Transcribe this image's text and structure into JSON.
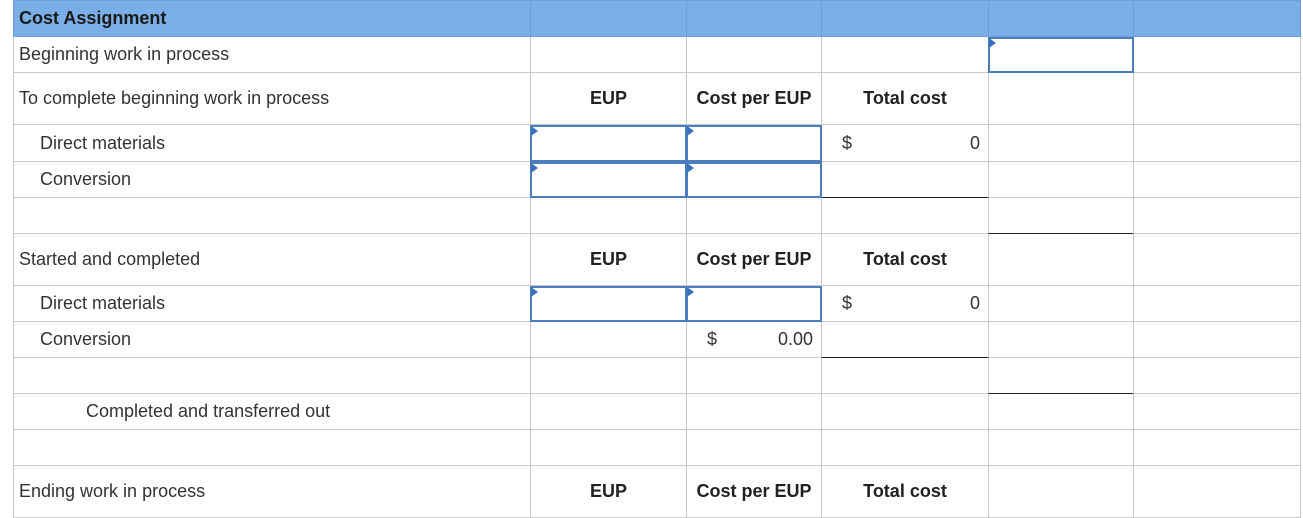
{
  "header": {
    "title": "Cost Assignment"
  },
  "rows": {
    "beginning_wip": "Beginning work in process",
    "to_complete": "To complete beginning work in process",
    "dm1": "Direct materials",
    "conv1": "Conversion",
    "started_completed": "Started and completed",
    "dm2": "Direct materials",
    "conv2": "Conversion",
    "completed_transferred": "Completed and transferred out",
    "ending_wip": "Ending work in process"
  },
  "columns": {
    "eup": "EUP",
    "cost_per_eup": "Cost per EUP",
    "total_cost": "Total cost"
  },
  "values": {
    "dollar": "$",
    "dm1_total": "0",
    "dm2_total": "0",
    "conv2_cost_per_eup": "0.00"
  }
}
